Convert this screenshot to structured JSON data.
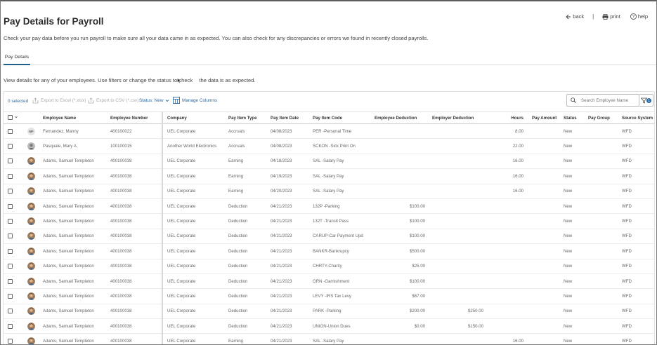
{
  "page": {
    "title": "Pay Details for Payroll",
    "description": "Check your pay data before you run payroll to make sure all your data came in as expected. You can also check for any discrepancies or errors we found in recently closed payrolls.",
    "subdescription": "View details for any of your employees. Use filters or change the status to check the data is as expected.",
    "subdescription_prefix": "View details for any of your employees. Use filters or change the status to check",
    "subdescription_suffix": "the data is as expected."
  },
  "top_actions": {
    "back": "back",
    "separator": "|",
    "print": "print",
    "help": "help"
  },
  "tabs": [
    {
      "label": "Pay Details",
      "active": true
    }
  ],
  "toolbar": {
    "selected": "0 selected",
    "export_excel": "Export to Excel (*.xlsx)",
    "export_csv": "Export to CSV (*.csv)",
    "status": "Status: New",
    "manage_columns": "Manage Columns",
    "search_placeholder": "Search Employee Name",
    "filter_count": "1"
  },
  "table": {
    "columns": [
      "Employee Name",
      "Employee Number",
      "Company",
      "Pay Item Type",
      "Pay Item Date",
      "Pay Item Code",
      "Employee Deduction",
      "Employer Deduction",
      "Hours",
      "Pay Amount",
      "Status",
      "Pay Group",
      "Source System"
    ],
    "rows": [
      {
        "avatar": "initials",
        "initials": "MF",
        "name": "Fernandez, Manny",
        "number": "400100022",
        "company": "UEL Corporate",
        "type": "Accruals",
        "date": "04/08/2023",
        "code": "PER -Personal Time",
        "emp_ded": "",
        "empr_ded": "",
        "hours": "8.00",
        "pay": "",
        "status": "New",
        "group": "",
        "source": "WFD"
      },
      {
        "avatar": "photo-gray",
        "initials": "",
        "name": "Pasquale, Mary A.",
        "number": "100100015",
        "company": "Another World Electronics",
        "type": "Accruals",
        "date": "04/08/2023",
        "code": "SCKON -Sick Print On",
        "emp_ded": "",
        "empr_ded": "",
        "hours": "22.00",
        "pay": "",
        "status": "New",
        "group": "",
        "source": "WFD"
      },
      {
        "avatar": "photo",
        "initials": "",
        "name": "Adams, Samuel Templeton",
        "number": "400100038",
        "company": "UEL Corporate",
        "type": "Earning",
        "date": "04/18/2023",
        "code": "SAL -Salary Pay",
        "emp_ded": "",
        "empr_ded": "",
        "hours": "16.00",
        "pay": "",
        "status": "New",
        "group": "",
        "source": "WFD"
      },
      {
        "avatar": "photo",
        "initials": "",
        "name": "Adams, Samuel Templeton",
        "number": "400100038",
        "company": "UEL Corporate",
        "type": "Earning",
        "date": "04/19/2023",
        "code": "SAL -Salary Pay",
        "emp_ded": "",
        "empr_ded": "",
        "hours": "16.00",
        "pay": "",
        "status": "New",
        "group": "",
        "source": "WFD"
      },
      {
        "avatar": "photo",
        "initials": "",
        "name": "Adams, Samuel Templeton",
        "number": "400100038",
        "company": "UEL Corporate",
        "type": "Earning",
        "date": "04/20/2023",
        "code": "SAL -Salary Pay",
        "emp_ded": "",
        "empr_ded": "",
        "hours": "16.00",
        "pay": "",
        "status": "New",
        "group": "",
        "source": "WFD"
      },
      {
        "avatar": "photo",
        "initials": "",
        "name": "Adams, Samuel Templeton",
        "number": "400100038",
        "company": "UEL Corporate",
        "type": "Deduction",
        "date": "04/21/2023",
        "code": "132P -Parking",
        "emp_ded": "$100.00",
        "empr_ded": "",
        "hours": "",
        "pay": "",
        "status": "New",
        "group": "",
        "source": "WFD"
      },
      {
        "avatar": "photo",
        "initials": "",
        "name": "Adams, Samuel Templeton",
        "number": "400100038",
        "company": "UEL Corporate",
        "type": "Deduction",
        "date": "04/21/2023",
        "code": "132T -Transit Pass",
        "emp_ded": "$100.00",
        "empr_ded": "",
        "hours": "",
        "pay": "",
        "status": "New",
        "group": "",
        "source": "WFD"
      },
      {
        "avatar": "photo",
        "initials": "",
        "name": "Adams, Samuel Templeton",
        "number": "400100038",
        "company": "UEL Corporate",
        "type": "Deduction",
        "date": "04/21/2023",
        "code": "CARUP-Car Payment Upd",
        "emp_ded": "$100.00",
        "empr_ded": "",
        "hours": "",
        "pay": "",
        "status": "New",
        "group": "",
        "source": "WFD"
      },
      {
        "avatar": "photo",
        "initials": "",
        "name": "Adams, Samuel Templeton",
        "number": "400100038",
        "company": "UEL Corporate",
        "type": "Deduction",
        "date": "04/21/2023",
        "code": "BANKR-Bankrupcy",
        "emp_ded": "$500.00",
        "empr_ded": "",
        "hours": "",
        "pay": "",
        "status": "New",
        "group": "",
        "source": "WFD"
      },
      {
        "avatar": "photo",
        "initials": "",
        "name": "Adams, Samuel Templeton",
        "number": "400100038",
        "company": "UEL Corporate",
        "type": "Deduction",
        "date": "04/21/2023",
        "code": "CHRTY-Charity",
        "emp_ded": "$25.00",
        "empr_ded": "",
        "hours": "",
        "pay": "",
        "status": "New",
        "group": "",
        "source": "WFD"
      },
      {
        "avatar": "photo",
        "initials": "",
        "name": "Adams, Samuel Templeton",
        "number": "400100038",
        "company": "UEL Corporate",
        "type": "Deduction",
        "date": "04/21/2023",
        "code": "GRN -Garnishment",
        "emp_ded": "$100.00",
        "empr_ded": "",
        "hours": "",
        "pay": "",
        "status": "New",
        "group": "",
        "source": "WFD"
      },
      {
        "avatar": "photo",
        "initials": "",
        "name": "Adams, Samuel Templeton",
        "number": "400100038",
        "company": "UEL Corporate",
        "type": "Deduction",
        "date": "04/21/2023",
        "code": "LEVY -IRS Tax Levy",
        "emp_ded": "$67.00",
        "empr_ded": "",
        "hours": "",
        "pay": "",
        "status": "New",
        "group": "",
        "source": "WFD"
      },
      {
        "avatar": "photo",
        "initials": "",
        "name": "Adams, Samuel Templeton",
        "number": "400100038",
        "company": "UEL Corporate",
        "type": "Deduction",
        "date": "04/21/2023",
        "code": "PARK -Parking",
        "emp_ded": "$200.00",
        "empr_ded": "$250.00",
        "hours": "",
        "pay": "",
        "status": "New",
        "group": "",
        "source": "WFD"
      },
      {
        "avatar": "photo",
        "initials": "",
        "name": "Adams, Samuel Templeton",
        "number": "400100038",
        "company": "UEL Corporate",
        "type": "Deduction",
        "date": "04/21/2023",
        "code": "UNION-Union Dues",
        "emp_ded": "$0.00",
        "empr_ded": "$150.00",
        "hours": "",
        "pay": "",
        "status": "New",
        "group": "",
        "source": "WFD"
      },
      {
        "avatar": "photo",
        "initials": "",
        "name": "Adams, Samuel Templeton",
        "number": "400100038",
        "company": "UEL Corporate",
        "type": "Earning",
        "date": "04/21/2023",
        "code": "SAL -Salary Pay",
        "emp_ded": "",
        "empr_ded": "",
        "hours": "16.00",
        "pay": "",
        "status": "New",
        "group": "",
        "source": "WFD"
      }
    ]
  },
  "colors": {
    "accent": "#2d6aa3",
    "tab_underline": "#1f5f8b",
    "text": "#333333",
    "muted": "#666666"
  },
  "icons": {
    "back": "arrow-left-icon",
    "print": "printer-icon",
    "help": "question-circle-icon",
    "excel": "export-icon",
    "csv": "export-icon",
    "manage": "table-columns-icon",
    "search": "search-icon",
    "filter": "filter-icon"
  }
}
